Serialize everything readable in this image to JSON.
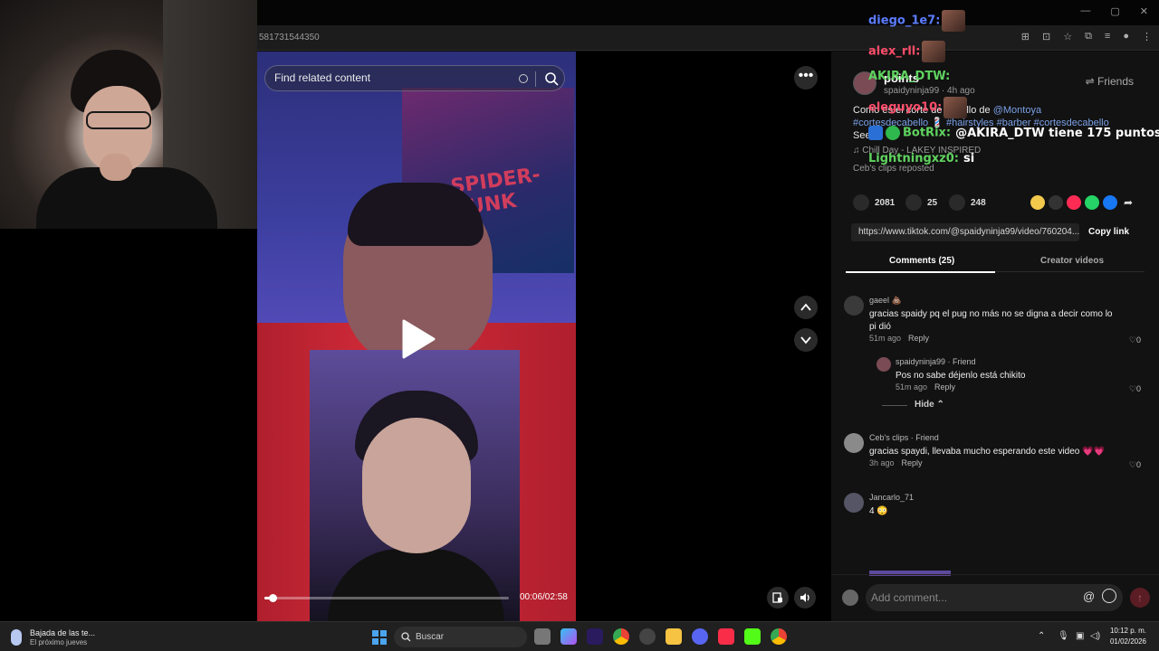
{
  "browser": {
    "url_fragment": "581731544350",
    "window_controls": [
      "—",
      "▢",
      "✕"
    ]
  },
  "video": {
    "search_placeholder": "Find related content",
    "time": "00:06/02:58",
    "progress": 0.035,
    "poster_text": "SPIDER-PUNK"
  },
  "author": {
    "name": "points",
    "sub": "spaidyninja99 · 4h ago",
    "friends_label": "Friends"
  },
  "caption": {
    "text": "Como es el corte de cabello de ",
    "mention": "@Montoya",
    "hashtags": "#cortesdecabello 💈 #hairstyles #barber #cortesdecabello",
    "more": "See"
  },
  "music": "♫  Chill Day - LAKEY INSPIRED",
  "repost": "Ceb's clips reposted",
  "stats": {
    "likes": "2081",
    "comments": "25",
    "saves": "248"
  },
  "share": {
    "url": "https://www.tiktok.com/@spaidyninja99/video/760204...",
    "copy_label": "Copy link"
  },
  "tabs": [
    {
      "label": "Comments (25)",
      "active": true
    },
    {
      "label": "Creator videos",
      "active": false
    }
  ],
  "comments": [
    {
      "name": "gaeel 💩",
      "text": "gracias spaidy pq el pug no más no se digna a decir como lo pi dió",
      "time": "51m ago",
      "reply": "Reply",
      "likes": "0"
    },
    {
      "name": "spaidyninja99 · Friend",
      "text": "Pos no sabe déjenlo está chikito",
      "time": "51m ago",
      "reply": "Reply",
      "likes": "0"
    },
    {
      "name": "Ceb's clips · Friend",
      "text": "gracias spaydi, llevaba mucho esperando este video 💗💗",
      "time": "3h ago",
      "reply": "Reply",
      "likes": "0"
    },
    {
      "name": "Jancarlo_71",
      "text": "4 😳",
      "time": "",
      "reply": "",
      "likes": ""
    }
  ],
  "hide_label": "Hide ⌃",
  "add_comment": {
    "placeholder": "Add comment..."
  },
  "chat": [
    {
      "user": "diego_1e7:",
      "msg": "",
      "color": "#5b7cff",
      "emote": true
    },
    {
      "user": "alex_rll:",
      "msg": "",
      "color": "#ff4d6a",
      "emote": true
    },
    {
      "user": "AKIRA_DTW:",
      "msg": "",
      "color": "#5fd35f",
      "emote": false
    },
    {
      "user": "eleguyo10:",
      "msg": "",
      "color": "#ff4d6a",
      "emote": true
    },
    {
      "user": "BotRix:",
      "msg": "@AKIRA_DTW tiene 175 puntos.",
      "color": "#5fd35f",
      "emote": false
    },
    {
      "user": "Lightningxz0:",
      "msg": "si",
      "color": "#5fd35f",
      "emote": false
    }
  ],
  "taskbar": {
    "weather_title": "Bajada de las te...",
    "weather_sub": "El próximo jueves",
    "search_label": "Buscar",
    "time": "10:12 p. m.",
    "date": "01/02/2026"
  },
  "colors": {
    "accent": "#fe2c55",
    "link": "#7aa0e6",
    "panel": "#121212"
  }
}
